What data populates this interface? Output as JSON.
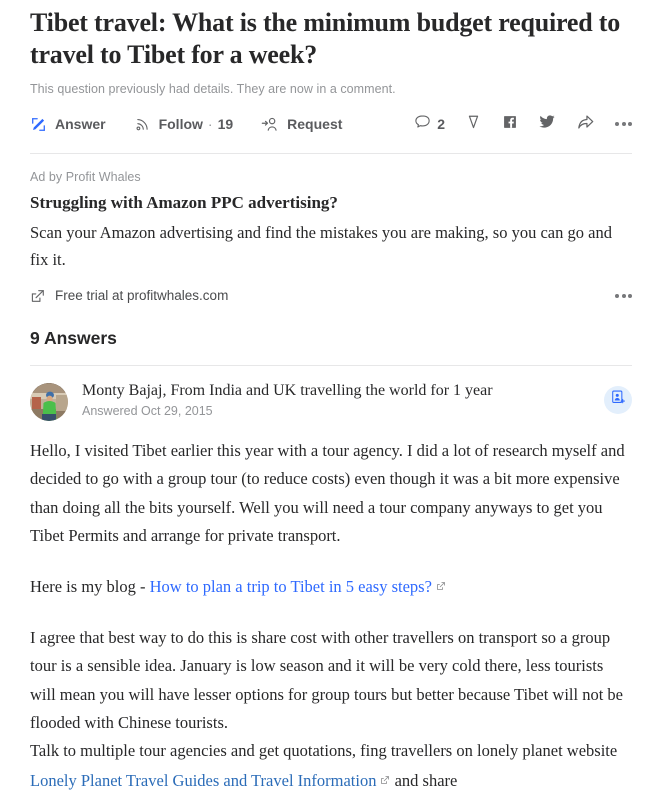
{
  "question": {
    "title": "Tibet travel: What is the minimum budget required to travel to Tibet for a week?",
    "subtitle": "This question previously had details. They are now in a comment.",
    "actions": {
      "answer_label": "Answer",
      "follow_label": "Follow",
      "follow_separator": "·",
      "follow_count": "19",
      "request_label": "Request",
      "comment_count": "2"
    }
  },
  "ad": {
    "ad_by": "Ad by Profit Whales",
    "headline": "Struggling with Amazon PPC advertising?",
    "body": "Scan your Amazon advertising and find the mistakes you are making, so you can go and fix it.",
    "cta": "Free trial at profitwhales.com"
  },
  "answers": {
    "heading": "9 Answers",
    "items": [
      {
        "author": "Monty Bajaj, From India and UK travelling the world for 1 year",
        "date": "Answered Oct 29, 2015",
        "para1": "Hello, I visited Tibet earlier this year with a tour agency. I did a lot of research myself and decided to go with a group tour (to reduce costs) even though it was a bit more expensive than doing all the bits yourself. Well you will need a tour company anyways to get you Tibet Permits and arrange for private transport.",
        "para2_prefix": "Here is my blog - ",
        "para2_link": "How to plan a trip to Tibet in 5 easy steps?",
        "para3": "I agree that best way to do this is share cost with other travellers on transport so a group tour is a sensible idea. January is low season and it will be very cold there, less tourists will mean you will have lesser options for group tours but better because Tibet will not be flooded with Chinese tourists.",
        "para4_prefix": "Talk to multiple tour agencies and get quotations, fing travellers on lonely planet website ",
        "para4_link": "Lonely Planet Travel Guides and Travel Information",
        "para4_suffix": " and share"
      }
    ]
  },
  "colors": {
    "accent_blue": "#2e69ff",
    "link_blue": "#2b6cb8",
    "text": "#282829",
    "muted": "#939598",
    "icon": "#636466",
    "divider": "#e7e7e8",
    "follow_bg": "#e3effc"
  },
  "icons": {
    "answer": "pencil-icon",
    "follow": "rss-icon",
    "request": "person-add-icon",
    "comment": "comment-icon",
    "downvote": "downvote-arrow-icon",
    "facebook": "facebook-icon",
    "twitter": "twitter-icon",
    "share": "share-arrow-icon",
    "more": "more-horizontal-icon",
    "external": "external-link-icon",
    "follow_user": "follow-user-icon"
  }
}
